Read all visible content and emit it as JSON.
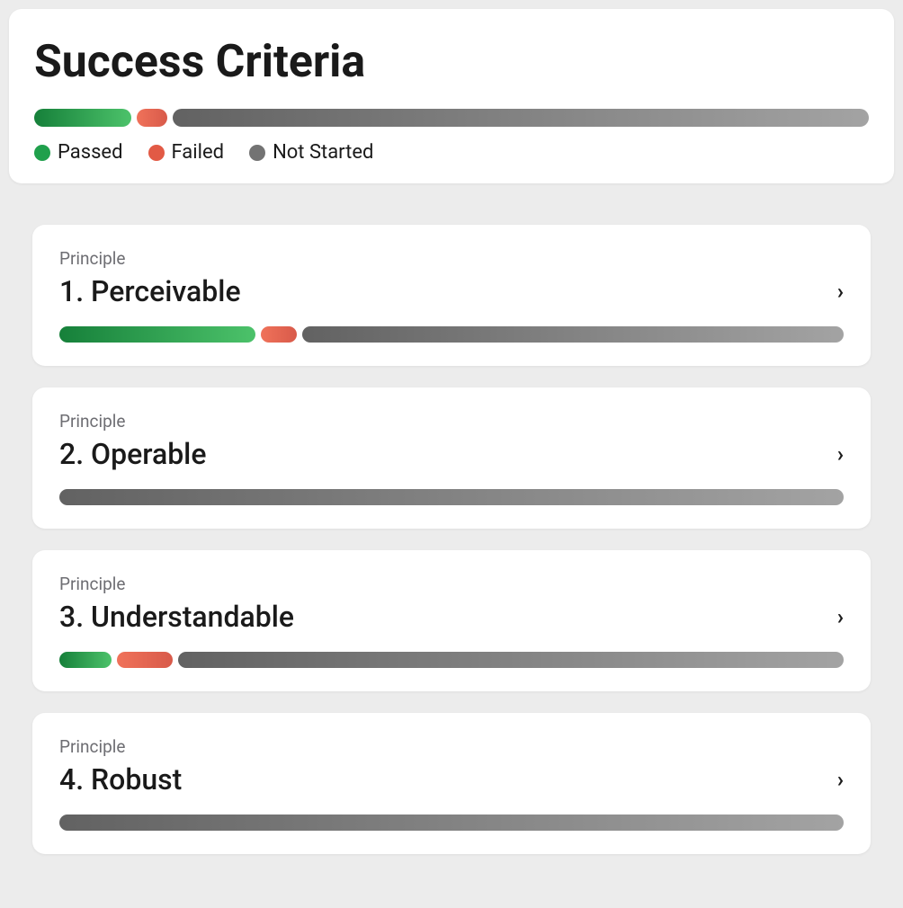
{
  "header": {
    "title": "Success Criteria",
    "overall": {
      "passed_width": 108,
      "failed_width": 34,
      "notstarted_flex": 1
    },
    "legend": {
      "passed": "Passed",
      "failed": "Failed",
      "notstarted": "Not Started"
    }
  },
  "label_principle": "Principle",
  "principles": [
    {
      "title": "1. Perceivable",
      "passed_width": 218,
      "failed_width": 40,
      "has_passed": true,
      "has_failed": true
    },
    {
      "title": "2. Operable",
      "passed_width": 0,
      "failed_width": 0,
      "has_passed": false,
      "has_failed": false
    },
    {
      "title": "3. Understandable",
      "passed_width": 58,
      "failed_width": 62,
      "has_passed": true,
      "has_failed": true
    },
    {
      "title": "4. Robust",
      "passed_width": 0,
      "failed_width": 0,
      "has_passed": false,
      "has_failed": false
    }
  ],
  "colors": {
    "passed_start": "#16803a",
    "passed_end": "#4cc26a",
    "failed_start": "#f0725a",
    "failed_end": "#d85a4a",
    "notstarted_start": "#626262",
    "notstarted_end": "#a3a3a3"
  }
}
